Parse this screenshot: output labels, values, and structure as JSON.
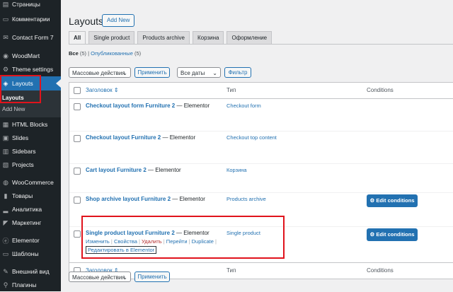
{
  "sidebar": {
    "items": [
      {
        "label": "Страницы",
        "icon": "pages-icon"
      },
      {
        "label": "Комментарии",
        "icon": "comments-icon"
      },
      {
        "label": "Contact Form 7",
        "icon": "mail-icon"
      },
      {
        "label": "WoodMart",
        "icon": "woodmart-icon"
      },
      {
        "label": "Theme settings",
        "icon": "settings-sliders-icon"
      },
      {
        "label": "Layouts",
        "icon": "layers-icon"
      },
      {
        "label": "HTML Blocks",
        "icon": "html-blocks-icon"
      },
      {
        "label": "Slides",
        "icon": "slides-icon"
      },
      {
        "label": "Sidebars",
        "icon": "sidebars-icon"
      },
      {
        "label": "Projects",
        "icon": "projects-icon"
      },
      {
        "label": "WooCommerce",
        "icon": "woocommerce-icon"
      },
      {
        "label": "Товары",
        "icon": "products-icon"
      },
      {
        "label": "Аналитика",
        "icon": "analytics-icon"
      },
      {
        "label": "Маркетинг",
        "icon": "marketing-icon"
      },
      {
        "label": "Elementor",
        "icon": "elementor-icon"
      },
      {
        "label": "Шаблоны",
        "icon": "templates-icon"
      },
      {
        "label": "Внешний вид",
        "icon": "appearance-icon"
      },
      {
        "label": "Плагины",
        "icon": "plugins-icon"
      }
    ],
    "submenu": {
      "current": "Layouts",
      "add_new": "Add New"
    }
  },
  "header": {
    "title": "Layouts",
    "add_new": "Add New"
  },
  "tabs": [
    {
      "label": "All",
      "active": true
    },
    {
      "label": "Single product"
    },
    {
      "label": "Products archive"
    },
    {
      "label": "Корзина"
    },
    {
      "label": "Оформление"
    }
  ],
  "filters": {
    "all_label": "Все",
    "all_count": "(5)",
    "published_label": "Опубликованные",
    "published_count": "(5)"
  },
  "bulk": {
    "select": "Массовые действия",
    "apply": "Применить",
    "dates": "Все даты",
    "filter": "Фильтр"
  },
  "table": {
    "col_title": "Заголовок",
    "col_type": "Тип",
    "col_conditions": "Conditions",
    "rows": [
      {
        "title": "Checkout layout form Furniture 2",
        "suffix": "— Elementor",
        "type": "Checkout form"
      },
      {
        "title": "Checkout layout Furniture 2",
        "suffix": "— Elementor",
        "type": "Checkout top content"
      },
      {
        "title": "Cart layout Furniture 2",
        "suffix": "— Elementor",
        "type": "Корзина"
      },
      {
        "title": "Shop archive layout Furniture 2",
        "suffix": "— Elementor",
        "type": "Products archive",
        "button": "Edit conditions"
      },
      {
        "title": "Single product layout Furniture 2",
        "suffix": "— Elementor",
        "type": "Single product",
        "button": "Edit conditions"
      }
    ],
    "row_actions": {
      "edit": "Изменить",
      "props": "Свойства",
      "delete": "Удалить",
      "view": "Перейти",
      "duplicate": "Duplicate",
      "elementor": "Редактировать в Elementor"
    }
  },
  "colors": {
    "sidebar_bg": "#1d2327",
    "accent": "#2271b1",
    "highlight": "#e0131c"
  }
}
